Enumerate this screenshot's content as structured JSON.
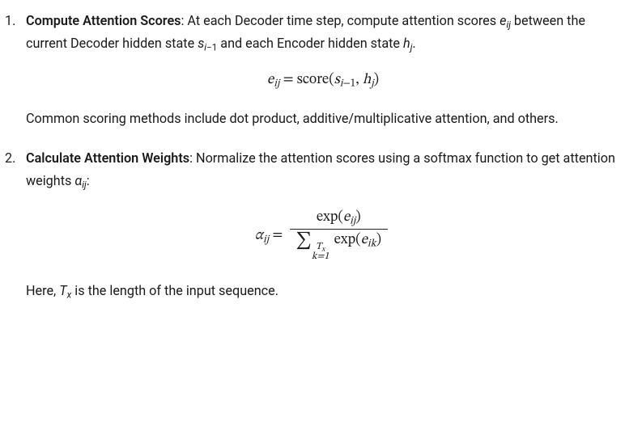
{
  "steps": [
    {
      "number": "1.",
      "title": "Compute Attention Scores",
      "intro_a": ": At each Decoder time step, compute attention scores ",
      "var_e": "e",
      "sub_ij": "ij",
      "intro_b": " between the current Decoder hidden state ",
      "var_s": "s",
      "sub_im1_i": "i",
      "sub_im1_minus": "−1",
      "intro_c": " and each Encoder hidden state ",
      "var_h": "h",
      "sub_j": "j",
      "intro_d": ".",
      "eq1": {
        "lhs_e": "e",
        "lhs_sub": "ij",
        "eq": " = ",
        "score": "score",
        "open": "(",
        "s": "s",
        "s_sub_i": "i",
        "s_sub_m1": "−1",
        "comma": ", ",
        "h": "h",
        "h_sub": "j",
        "close": ")"
      },
      "after": "Common scoring methods include dot product, additive/multiplicative attention, and others."
    },
    {
      "number": "2.",
      "title": "Calculate Attention Weights",
      "intro_a": ": Normalize the attention scores using a softmax function to get attention weights ",
      "var_alpha": "α",
      "sub_ij": "ij",
      "intro_b": ":",
      "eq2": {
        "lhs_a": "α",
        "lhs_sub": "ij",
        "eq": " = ",
        "exp": "exp",
        "open": "(",
        "e": "e",
        "e_sub": "ij",
        "close": ")",
        "sigma": "∑",
        "sum_sup_T": "T",
        "sum_sup_x": "x",
        "sum_sub": "k=1",
        "e_sub2": "ik"
      },
      "after_a": "Here, ",
      "after_T": "T",
      "after_Tx": "x",
      "after_b": " is the length of the input sequence."
    }
  ]
}
